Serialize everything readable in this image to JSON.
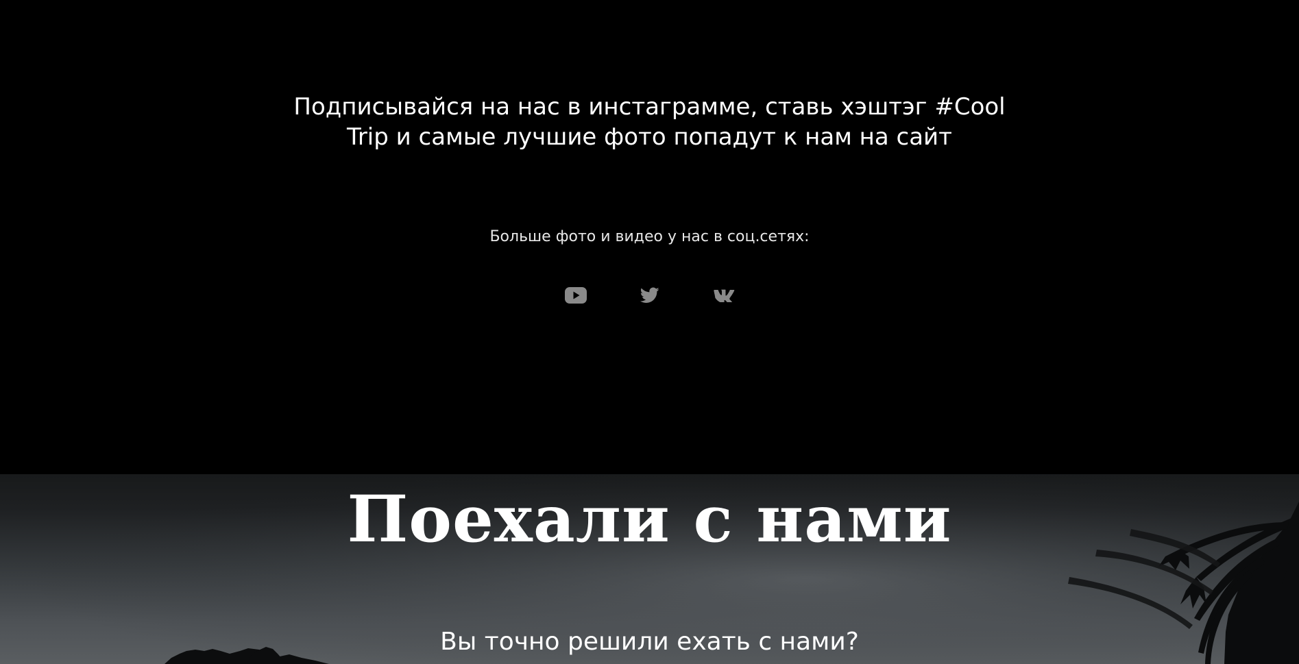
{
  "instagram": {
    "line1": "Подписывайся на нас в инстаграмме, ставь хэштэг #Cool",
    "line2": "Trip и самые лучшие фото попадут к нам на сайт"
  },
  "social": {
    "caption": "Больше фото и видео у нас в соц.сетях:",
    "icon_color": "#8a8a8a",
    "links": [
      {
        "icon": "youtube-icon"
      },
      {
        "icon": "twitter-icon"
      },
      {
        "icon": "vk-icon"
      }
    ]
  },
  "hero": {
    "title": "Поехали с нами",
    "question": "Вы точно решили ехать с нами?"
  }
}
